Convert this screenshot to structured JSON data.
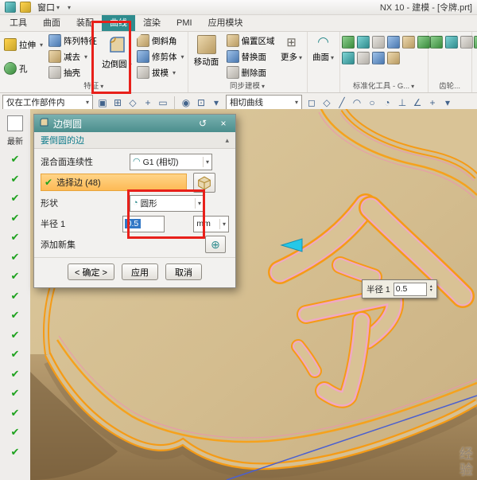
{
  "titlebar": {
    "window_menu": "窗口",
    "title": "NX 10 - 建模 - [令牌.prt]"
  },
  "tabs": [
    {
      "label": "工具"
    },
    {
      "label": "曲面"
    },
    {
      "label": "装配"
    },
    {
      "label": "曲线"
    },
    {
      "label": "渲染"
    },
    {
      "label": "PMI"
    },
    {
      "label": "应用模块"
    }
  ],
  "ribbon": {
    "extrude": "拉伸",
    "hole": "孔",
    "pattern_feature": "阵列特征",
    "subtract": "减去",
    "shell": "抽壳",
    "edge_blend": "边倒圆",
    "chamfer": "倒斜角",
    "trim_body": "修剪体",
    "draft": "拔模",
    "move_face": "移动面",
    "offset_region": "偏置区域",
    "replace_face": "替换面",
    "delete_face": "删除面",
    "more": "更多",
    "surface": "曲面",
    "group_feature": "特征",
    "group_sync": "同步建模",
    "group_std": "标准化工具 - G...",
    "group_gear": "齿轮...",
    "group_spring": "弹簧...",
    "std_tool_icon_count": 10,
    "gear_icon_count": 4,
    "spring_icon_count": 4
  },
  "selection_bar": {
    "scope": "仅在工作部件内",
    "curve_rule": "相切曲线",
    "left_icons": [
      "▣",
      "⊞",
      "◇",
      "+",
      "▭"
    ],
    "mid_icons": [
      "◉",
      "⊡",
      "▾"
    ],
    "right_icons": [
      "◻",
      "◇",
      "╱",
      "◠",
      "○",
      "◔",
      "⊥",
      "∠",
      "+",
      "▾"
    ]
  },
  "navigator": {
    "latest_label": "最新",
    "check_count": 16
  },
  "dialog": {
    "title": "边倒圆",
    "section_edge": "要倒圆的边",
    "continuity_label": "混合面连续性",
    "continuity_value": "G1 (相切)",
    "select_edge_label": "选择边 (48)",
    "shape_label": "形状",
    "shape_value": "圆形",
    "radius_label": "半径 1",
    "radius_value": "0.5",
    "radius_unit": "mm",
    "add_new_set_label": "添加新集",
    "ok_label": "< 确定 >",
    "apply_label": "应用",
    "cancel_label": "取消",
    "reset_icon": "↺",
    "close_icon": "×"
  },
  "viewport": {
    "glyph": "令",
    "floating_radius_label": "半径 1",
    "floating_radius_value": "0.5",
    "watermark": "经验"
  },
  "colors": {
    "accent_teal": "#2f8c8e",
    "annotation_red": "#e8201a",
    "model_tan": "#d5bf92",
    "edge_highlight": "#f59b16",
    "check_green": "#1ea21e"
  }
}
